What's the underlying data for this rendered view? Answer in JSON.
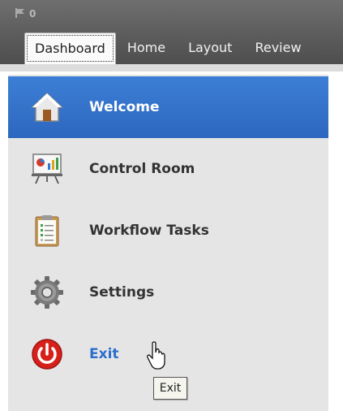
{
  "header": {
    "flag_count": "0",
    "tabs": [
      {
        "label": "Dashboard",
        "active": true
      },
      {
        "label": "Home"
      },
      {
        "label": "Layout"
      },
      {
        "label": "Review"
      }
    ]
  },
  "sidebar": {
    "items": [
      {
        "label": "Welcome",
        "icon": "home-icon",
        "selected": true
      },
      {
        "label": "Control Room",
        "icon": "presentation-chart-icon"
      },
      {
        "label": "Workflow Tasks",
        "icon": "clipboard-icon"
      },
      {
        "label": "Settings",
        "icon": "gear-icon"
      },
      {
        "label": "Exit",
        "icon": "power-icon"
      }
    ]
  },
  "tooltip": {
    "text": "Exit"
  },
  "colors": {
    "selected": "#2f6ec6",
    "exit_label": "#2b6fcc",
    "sidebar_bg": "#e5e5e5"
  }
}
